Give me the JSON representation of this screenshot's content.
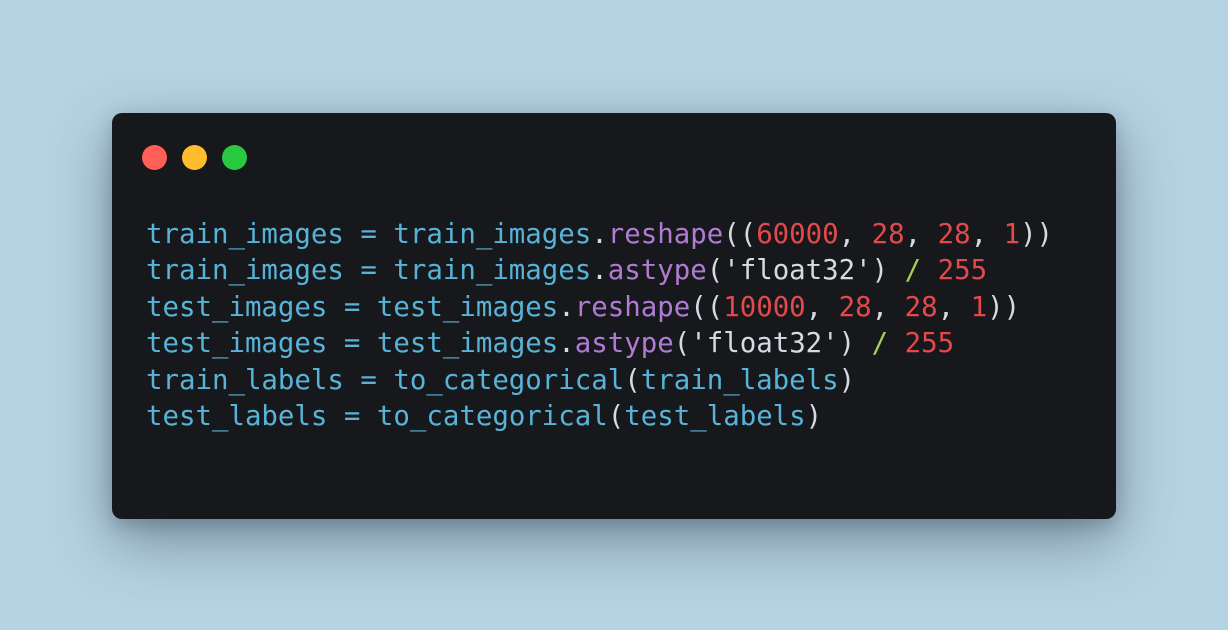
{
  "window": {
    "controls": [
      {
        "name": "close",
        "color": "#ff5f57"
      },
      {
        "name": "minimize",
        "color": "#febc2e"
      },
      {
        "name": "zoom",
        "color": "#28c840"
      }
    ]
  },
  "code_lines": [
    {
      "tokens": [
        {
          "t": "train_images",
          "k": "ident"
        },
        {
          "t": " = ",
          "k": "op"
        },
        {
          "t": "train_images",
          "k": "ident"
        },
        {
          "t": ".",
          "k": "punc"
        },
        {
          "t": "reshape",
          "k": "method"
        },
        {
          "t": "((",
          "k": "punc"
        },
        {
          "t": "60000",
          "k": "num"
        },
        {
          "t": ", ",
          "k": "punc"
        },
        {
          "t": "28",
          "k": "num"
        },
        {
          "t": ", ",
          "k": "punc"
        },
        {
          "t": "28",
          "k": "num"
        },
        {
          "t": ", ",
          "k": "punc"
        },
        {
          "t": "1",
          "k": "num"
        },
        {
          "t": "))",
          "k": "punc"
        }
      ]
    },
    {
      "tokens": [
        {
          "t": "train_images",
          "k": "ident"
        },
        {
          "t": " = ",
          "k": "op"
        },
        {
          "t": "train_images",
          "k": "ident"
        },
        {
          "t": ".",
          "k": "punc"
        },
        {
          "t": "astype",
          "k": "method"
        },
        {
          "t": "(",
          "k": "punc"
        },
        {
          "t": "'float32'",
          "k": "str"
        },
        {
          "t": ") ",
          "k": "punc"
        },
        {
          "t": "/",
          "k": "div"
        },
        {
          "t": " ",
          "k": "punc"
        },
        {
          "t": "255",
          "k": "num"
        }
      ]
    },
    {
      "tokens": [
        {
          "t": "test_images",
          "k": "ident"
        },
        {
          "t": " = ",
          "k": "op"
        },
        {
          "t": "test_images",
          "k": "ident"
        },
        {
          "t": ".",
          "k": "punc"
        },
        {
          "t": "reshape",
          "k": "method"
        },
        {
          "t": "((",
          "k": "punc"
        },
        {
          "t": "10000",
          "k": "num"
        },
        {
          "t": ", ",
          "k": "punc"
        },
        {
          "t": "28",
          "k": "num"
        },
        {
          "t": ", ",
          "k": "punc"
        },
        {
          "t": "28",
          "k": "num"
        },
        {
          "t": ", ",
          "k": "punc"
        },
        {
          "t": "1",
          "k": "num"
        },
        {
          "t": "))",
          "k": "punc"
        }
      ]
    },
    {
      "tokens": [
        {
          "t": "test_images",
          "k": "ident"
        },
        {
          "t": " = ",
          "k": "op"
        },
        {
          "t": "test_images",
          "k": "ident"
        },
        {
          "t": ".",
          "k": "punc"
        },
        {
          "t": "astype",
          "k": "method"
        },
        {
          "t": "(",
          "k": "punc"
        },
        {
          "t": "'float32'",
          "k": "str"
        },
        {
          "t": ") ",
          "k": "punc"
        },
        {
          "t": "/",
          "k": "div"
        },
        {
          "t": " ",
          "k": "punc"
        },
        {
          "t": "255",
          "k": "num"
        }
      ]
    },
    {
      "tokens": [
        {
          "t": "train_labels",
          "k": "ident"
        },
        {
          "t": " = ",
          "k": "op"
        },
        {
          "t": "to_categorical",
          "k": "ident"
        },
        {
          "t": "(",
          "k": "punc"
        },
        {
          "t": "train_labels",
          "k": "ident"
        },
        {
          "t": ")",
          "k": "punc"
        }
      ]
    },
    {
      "tokens": [
        {
          "t": "test_labels",
          "k": "ident"
        },
        {
          "t": " = ",
          "k": "op"
        },
        {
          "t": "to_categorical",
          "k": "ident"
        },
        {
          "t": "(",
          "k": "punc"
        },
        {
          "t": "test_labels",
          "k": "ident"
        },
        {
          "t": ")",
          "k": "punc"
        }
      ]
    }
  ]
}
